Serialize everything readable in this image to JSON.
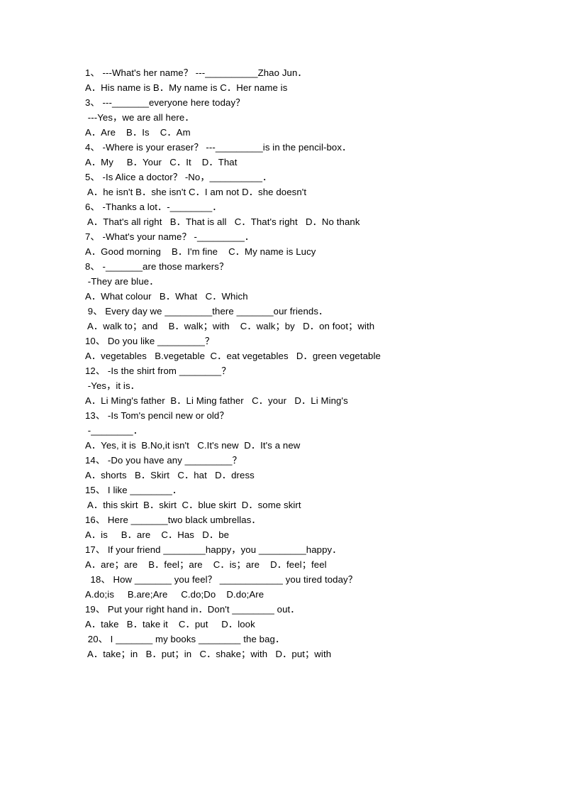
{
  "document": {
    "type": "multiple-choice-worksheet",
    "language": "English",
    "background_color": "#ffffff",
    "text_color": "#000000",
    "lines": [
      "1、 ---What's her name？ ---__________Zhao Jun．",
      "A．His name is B．My name is C．Her name is",
      "3、 ---_______everyone here today？",
      " ---Yes，we are all here．",
      "A．Are    B．Is    C．Am",
      "4、 -Where is your eraser？ ---_________is in the pencil-box．",
      "A．My     B．Your   C．It    D．That",
      "5、 -Is Alice a doctor？ -No，__________．",
      " A．he isn't B．she isn't C．I am not D．she doesn't",
      "6、 -Thanks a lot．-________．",
      " A．That's all right   B．That is all   C．That's right   D．No thank",
      "7、 -What's your name？ -_________．",
      "A．Good morning    B．I'm fine    C．My name is Lucy",
      "8、 -_______are those markers？",
      " -They are blue．",
      "A．What colour   B．What   C．Which",
      " 9、 Every day we _________there _______our friends．",
      " A．walk to；and    B．walk；with    C．walk；by   D．on foot；with",
      "10、 Do you like _________？",
      "A．vegetables   B.vegetable  C．eat vegetables   D．green vegetable",
      "12、 -Is the shirt from ________？",
      " -Yes，it is．",
      "A．Li Ming's father  B．Li Ming father   C．your   D．Li Ming's",
      "13、 -Is Tom's pencil new or old？",
      " -________．",
      "A．Yes, it is  B.No,it isn't   C.It's new  D．It's a new",
      "14、 -Do you have any _________？",
      "A．shorts   B．Skirt   C．hat   D．dress",
      "15、 I like ________．",
      " A．this skirt  B．skirt  C．blue skirt  D．some skirt",
      "16、 Here _______two black umbrellas．",
      "A．is     B．are    C．Has   D．be",
      "17、 If your friend ________happy，you _________happy．",
      "A．are；are    B．feel；are    C．is；are    D．feel；feel",
      "  18、 How _______ you feel？ ____________ you tired today？",
      "A.do;is     B.are;Are     C.do;Do    D.do;Are",
      "19、 Put your right hand in．Don't ________ out．",
      "A．take   B．take it    C．put     D．look",
      " 20、 I _______ my books ________ the bag．",
      " A．take；in   B．put；in   C．shake；with   D．put；with"
    ],
    "questions": [
      {
        "number": "1",
        "stem": "---What's her name？ ---__________Zhao Jun．",
        "options": [
          "A．His name is",
          "B．My name is",
          "C．Her name is"
        ]
      },
      {
        "number": "3",
        "stem": "---_______everyone here today？",
        "stem_continued": "---Yes，we are all here．",
        "options": [
          "A．Are",
          "B．Is",
          "C．Am"
        ]
      },
      {
        "number": "4",
        "stem": "-Where is your eraser？ ---_________is in the pencil-box．",
        "options": [
          "A．My",
          "B．Your",
          "C．It",
          "D．That"
        ]
      },
      {
        "number": "5",
        "stem": "-Is Alice a doctor？ -No，__________．",
        "options": [
          "A．he isn't",
          "B．she isn't",
          "C．I am not",
          "D．she doesn't"
        ]
      },
      {
        "number": "6",
        "stem": "-Thanks a lot．-________．",
        "options": [
          "A．That's all right",
          "B．That is all",
          "C．That's right",
          "D．No thank"
        ]
      },
      {
        "number": "7",
        "stem": "-What's your name？ -_________．",
        "options": [
          "A．Good morning",
          "B．I'm fine",
          "C．My name is Lucy"
        ]
      },
      {
        "number": "8",
        "stem": "-_______are those markers？",
        "stem_continued": "-They are blue．",
        "options": [
          "A．What colour",
          "B．What",
          "C．Which"
        ]
      },
      {
        "number": "9",
        "stem": "Every day we _________there _______our friends．",
        "options": [
          "A．walk to；and",
          "B．walk；with",
          "C．walk；by",
          "D．on foot；with"
        ]
      },
      {
        "number": "10",
        "stem": "Do you like _________？",
        "options": [
          "A．vegetables",
          "B.vegetable",
          "C．eat vegetables",
          "D．green vegetable"
        ]
      },
      {
        "number": "12",
        "stem": "-Is the shirt from ________？",
        "stem_continued": "-Yes，it is．",
        "options": [
          "A．Li Ming's father",
          "B．Li Ming father",
          "C．your",
          "D．Li Ming's"
        ]
      },
      {
        "number": "13",
        "stem": "-Is Tom's pencil new or old？",
        "stem_continued": "-________．",
        "options": [
          "A．Yes, it is",
          "B.No,it isn't",
          "C.It's new",
          "D．It's a new"
        ]
      },
      {
        "number": "14",
        "stem": "-Do you have any _________？",
        "options": [
          "A．shorts",
          "B．Skirt",
          "C．hat",
          "D．dress"
        ]
      },
      {
        "number": "15",
        "stem": "I like ________．",
        "options": [
          "A．this skirt",
          "B．skirt",
          "C．blue skirt",
          "D．some skirt"
        ]
      },
      {
        "number": "16",
        "stem": "Here _______two black umbrellas．",
        "options": [
          "A．is",
          "B．are",
          "C．Has",
          "D．be"
        ]
      },
      {
        "number": "17",
        "stem": "If your friend ________happy，you _________happy．",
        "options": [
          "A．are；are",
          "B．feel；are",
          "C．is；are",
          "D．feel；feel"
        ]
      },
      {
        "number": "18",
        "stem": "How _______ you feel？ ____________ you tired today？",
        "options": [
          "A.do;is",
          "B.are;Are",
          "C.do;Do",
          "D.do;Are"
        ]
      },
      {
        "number": "19",
        "stem": "Put your right hand in．Don't ________ out．",
        "options": [
          "A．take",
          "B．take it",
          "C．put",
          "D．look"
        ]
      },
      {
        "number": "20",
        "stem": "I _______ my books ________ the bag．",
        "options": [
          "A．take；in",
          "B．put；in",
          "C．shake；with",
          "D．put；with"
        ]
      }
    ]
  }
}
